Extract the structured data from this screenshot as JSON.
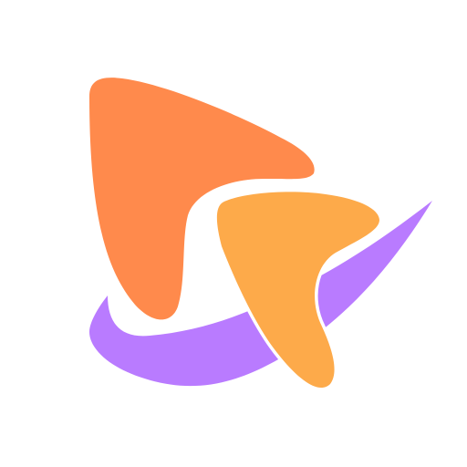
{
  "logo": {
    "icon": "abstract-play-swoosh-logo-icon",
    "colors": {
      "background": "#FFFFFF",
      "orange_shape": "#FF8A4C",
      "amber_shape": "#FDAA4A",
      "purple_swoosh": "#B97BFF"
    }
  }
}
